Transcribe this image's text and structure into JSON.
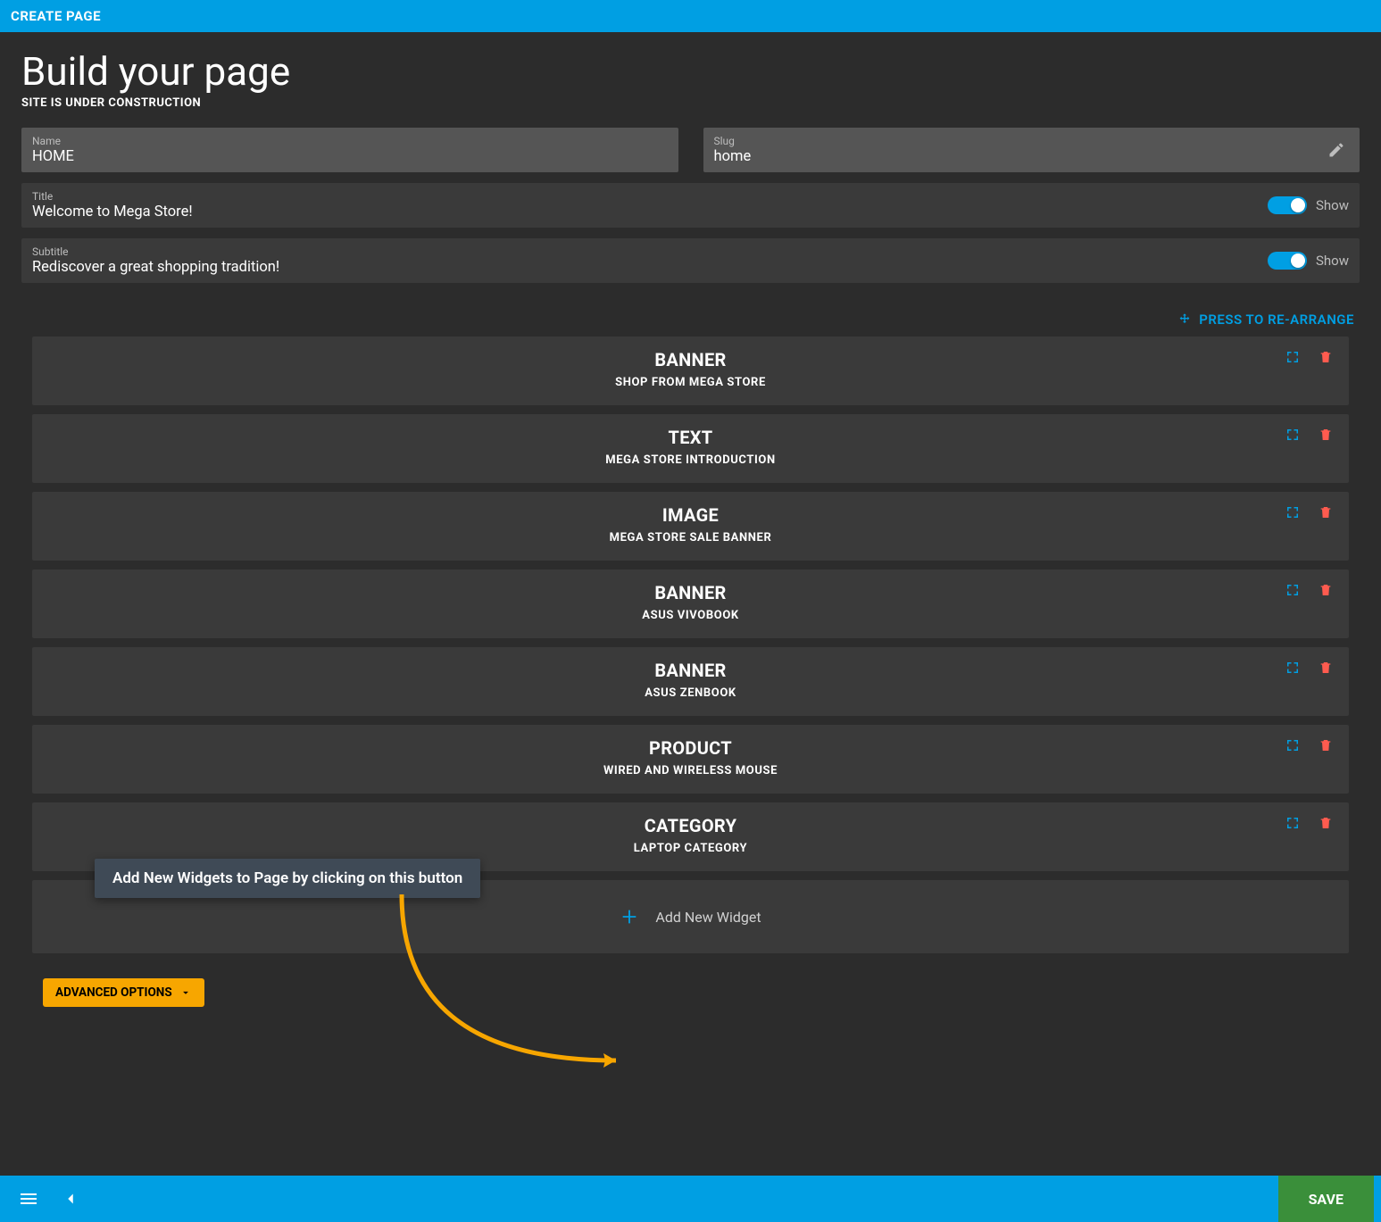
{
  "topbar": {
    "heading": "CREATE PAGE"
  },
  "page": {
    "title": "Build your page",
    "subtitle": "SITE IS UNDER CONSTRUCTION"
  },
  "fields": {
    "name_label": "Name",
    "name_value": "HOME",
    "slug_label": "Slug",
    "slug_value": "home",
    "title_label": "Title",
    "title_value": "Welcome to Mega Store!",
    "title_show": "Show",
    "subtitle_label": "Subtitle",
    "subtitle_value": "Rediscover a great shopping tradition!",
    "subtitle_show": "Show"
  },
  "rearrange_label": "PRESS TO RE-ARRANGE",
  "widgets": [
    {
      "type": "BANNER",
      "desc": "SHOP FROM MEGA STORE"
    },
    {
      "type": "TEXT",
      "desc": "MEGA STORE INTRODUCTION"
    },
    {
      "type": "IMAGE",
      "desc": "MEGA STORE SALE BANNER"
    },
    {
      "type": "BANNER",
      "desc": "ASUS VIVOBOOK"
    },
    {
      "type": "BANNER",
      "desc": "ASUS ZENBOOK"
    },
    {
      "type": "PRODUCT",
      "desc": "WIRED AND WIRELESS MOUSE"
    },
    {
      "type": "CATEGORY",
      "desc": "LAPTOP CATEGORY"
    }
  ],
  "add_widget_label": "Add New Widget",
  "tooltip_text": "Add New Widgets to Page by clicking on this button",
  "advanced_label": "ADVANCED OPTIONS",
  "save_label": "SAVE",
  "colors": {
    "brand": "#009fe3",
    "accent_orange": "#f7a600",
    "danger": "#ff5b4f",
    "save_green": "#3a8f3a"
  }
}
